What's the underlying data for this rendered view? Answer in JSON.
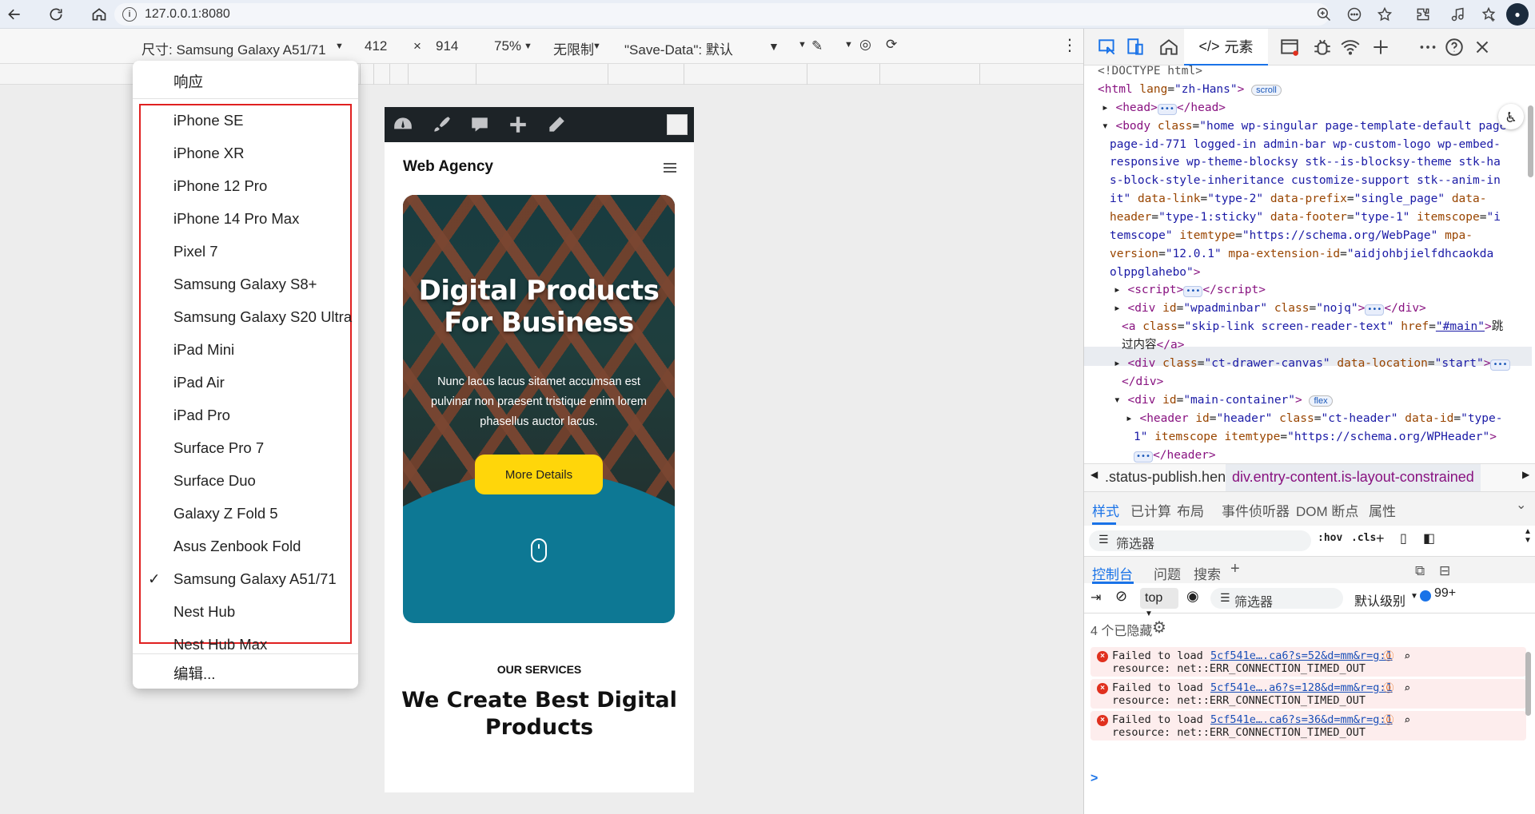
{
  "browser": {
    "url": "127.0.0.1:8080",
    "icons": [
      "back-icon",
      "refresh-icon",
      "home-icon",
      "info-icon",
      "zoom-icon",
      "more-icon",
      "favorite-icon",
      "extensions-icon",
      "music-icon",
      "collections-icon",
      "profile-avatar"
    ]
  },
  "device_toolbar": {
    "size_label": "尺寸: Samsung Galaxy A51/71",
    "width": "412",
    "times": "×",
    "height": "914",
    "zoom": "75%",
    "throttle": "无限制",
    "save_data": "\"Save-Data\": 默认"
  },
  "dropdown": {
    "responsive": "响应",
    "devices": [
      "iPhone SE",
      "iPhone XR",
      "iPhone 12 Pro",
      "iPhone 14 Pro Max",
      "Pixel 7",
      "Samsung Galaxy S8+",
      "Samsung Galaxy S20 Ultra",
      "iPad Mini",
      "iPad Air",
      "iPad Pro",
      "Surface Pro 7",
      "Surface Duo",
      "Galaxy Z Fold 5",
      "Asus Zenbook Fold",
      "Samsung Galaxy A51/71",
      "Nest Hub",
      "Nest Hub Max"
    ],
    "selected": "Samsung Galaxy A51/71",
    "edit": "编辑..."
  },
  "site": {
    "title": "Web Agency",
    "hero_title_1": "Digital Products",
    "hero_title_2": "For Business",
    "hero_text": "Nunc lacus lacus sitamet accumsan est pulvinar non praesent tristique enim lorem phasellus auctor lacus.",
    "hero_button": "More Details",
    "services_label": "OUR SERVICES",
    "services_title_1": "We Create Best Digital",
    "services_title_2": "Products"
  },
  "devtools": {
    "elements_tab": "元素",
    "breadcrumb_1": ".status-publish.hentry",
    "breadcrumb_2": "div.entry-content.is-layout-constrained",
    "styles_tabs": [
      "样式",
      "已计算",
      "布局",
      "事件侦听器",
      "DOM 断点",
      "属性"
    ],
    "filter_placeholder": "筛选器",
    "hov": ":hov",
    "cls": ".cls",
    "console_tabs": [
      "控制台",
      "问题",
      "搜索"
    ],
    "context": "top",
    "console_filter": "筛选器",
    "level": "默认级别",
    "issues_count": "99+",
    "hidden": "4 个已隐藏",
    "errors": [
      {
        "msg1": "Failed to load",
        "link": "5cf541e….ca6?s=52&d=mm&r=g:1",
        "msg2": "resource: net::ERR_CONNECTION_TIMED_OUT"
      },
      {
        "msg1": "Failed to load",
        "link": "5cf541e….a6?s=128&d=mm&r=g:1",
        "msg2": "resource: net::ERR_CONNECTION_TIMED_OUT"
      },
      {
        "msg1": "Failed to load",
        "link": "5cf541e….ca6?s=36&d=mm&r=g:1",
        "msg2": "resource: net::ERR_CONNECTION_TIMED_OUT"
      }
    ],
    "prompt": ">"
  },
  "colors": {
    "accent": "#1a73e8",
    "hero_button": "#ffd60a",
    "hero_bg": "#0d7894",
    "highlight": "#e02020"
  }
}
